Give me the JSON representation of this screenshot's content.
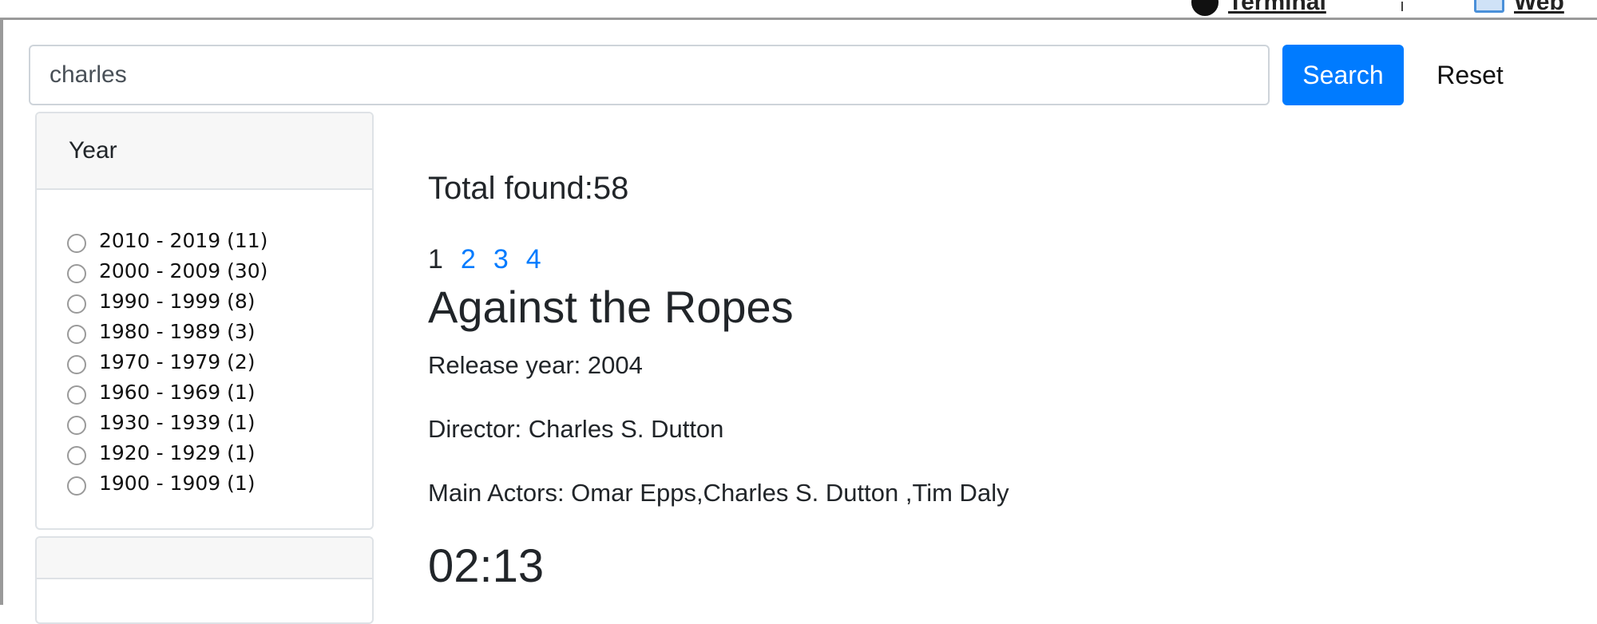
{
  "topbar": {
    "terminal_label": "Terminal",
    "web_label": "Web"
  },
  "search": {
    "value": "charles",
    "button_label": "Search",
    "reset_label": "Reset"
  },
  "facets": {
    "year": {
      "title": "Year",
      "options": [
        {
          "label": "2010 - 2019 (11)"
        },
        {
          "label": "2000 - 2009 (30)"
        },
        {
          "label": "1990 - 1999 (8)"
        },
        {
          "label": "1980 - 1989 (3)"
        },
        {
          "label": "1970 - 1979 (2)"
        },
        {
          "label": "1960 - 1969 (1)"
        },
        {
          "label": "1930 - 1939 (1)"
        },
        {
          "label": "1920 - 1929 (1)"
        },
        {
          "label": "1900 - 1909 (1)"
        }
      ]
    },
    "second": {
      "title": ""
    }
  },
  "results": {
    "total_text": "Total found:58",
    "pages": [
      "1",
      "2",
      "3",
      "4"
    ],
    "current_page": "1",
    "first": {
      "title": "Against the Ropes",
      "release_year": "Release year: 2004",
      "director": "Director: Charles S. Dutton",
      "actors": "Main Actors: Omar Epps,Charles S. Dutton ,Tim Daly",
      "duration": "02:13"
    }
  },
  "colors": {
    "primary": "#007bff",
    "text": "#212529",
    "card_header_bg": "#f7f7f7",
    "border": "#dee2e6"
  }
}
